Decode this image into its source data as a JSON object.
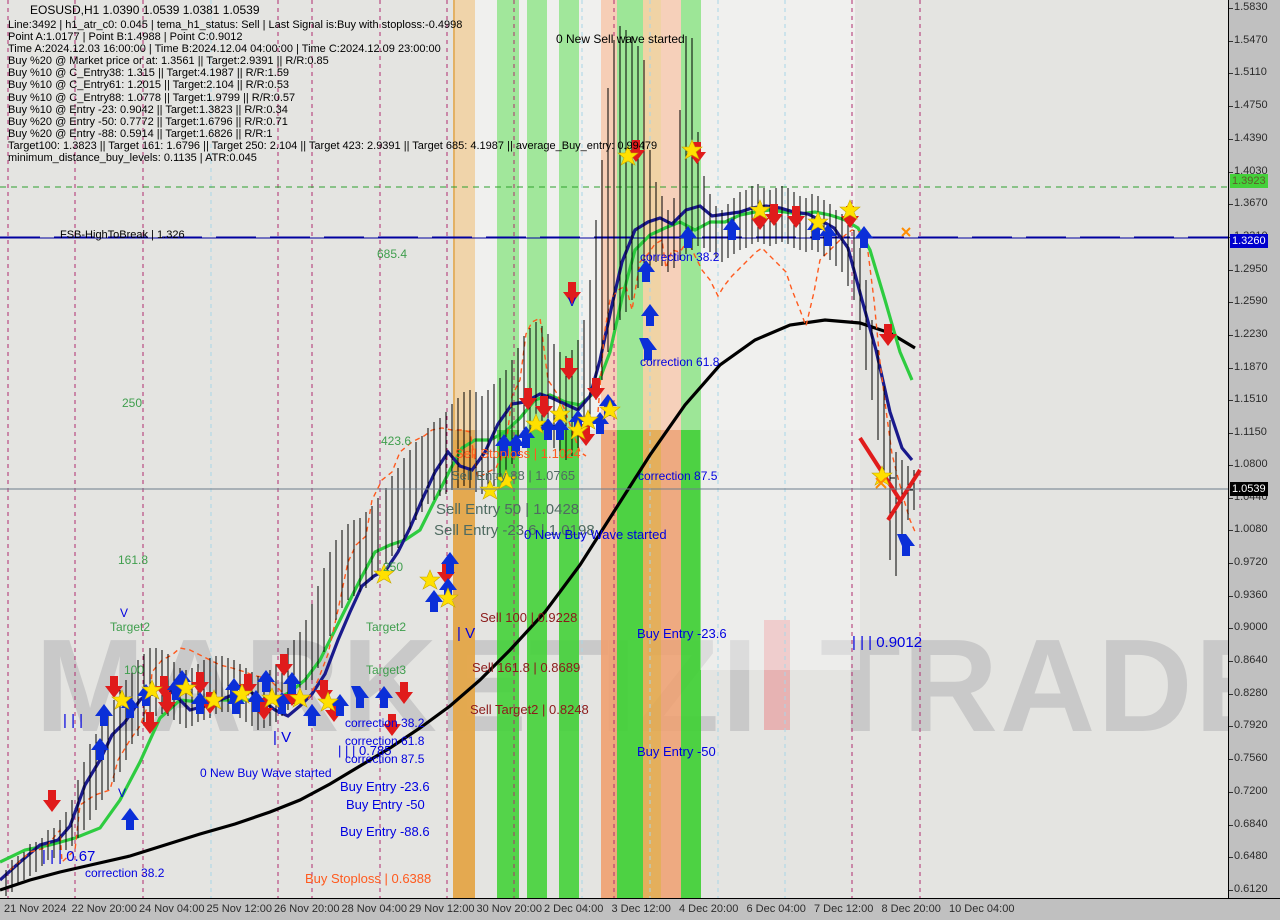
{
  "window": {
    "background": "#c0c0c0",
    "plot_background": "#e4e4e1"
  },
  "header": {
    "symbol_line": "EOSUSD,H1  1.0390 1.0539 1.0381 1.0539",
    "info_lines": [
      "Line:3492 | h1_atr_c0: 0.045 | tema_h1_status: Sell | Last Signal is:Buy with stoploss:-0.4998",
      "Point A:1.0177 | Point B:1.4988 | Point C:0.9012",
      "Time A:2024.12.03 16:00:00 | Time B:2024.12.04 04:00:00 | Time C:2024.12.09 23:00:00",
      "Buy %20 @ Market price or at: 1.3561 || Target:2.9391 || R/R:0.85",
      "Buy %10 @ C_Entry38: 1.315 || Target:4.1987 || R/R:1.59",
      "Buy %10 @ C_Entry61: 1.2015 || Target:2.104 || R/R:0.53",
      "Buy %10 @ C_Entry88: 1.0778 || Target:1.9799 || R/R:0.57",
      "Buy %10 @ Entry -23: 0.9042 || Target:1.3823 || R/R:0.34",
      "Buy %20 @ Entry -50: 0.7772 || Target:1.6796 || R/R:0.71",
      "Buy %20 @ Entry -88: 0.5914 || Target:1.6826 || R/R:1",
      "Target100: 1.3823 || Target 161: 1.6796 || Target 250: 2.104 || Target 423: 2.9391 || Target 685: 4.1987 || average_Buy_entry: 0.99479",
      "minimum_distance_buy_levels: 0.1135 | ATR:0.045"
    ]
  },
  "chart_data": {
    "type": "line",
    "title": "EOSUSD,H1",
    "timeframe": "H1",
    "ohlc": {
      "open": 1.039,
      "high": 1.0539,
      "low": 1.0381,
      "close": 1.0539
    },
    "xlabel": "",
    "ylabel": "",
    "ylim": [
      0.612,
      1.583
    ],
    "grid": false,
    "y_ticks": [
      1.583,
      1.547,
      1.511,
      1.475,
      1.439,
      1.403,
      1.367,
      1.331,
      1.295,
      1.259,
      1.223,
      1.187,
      1.151,
      1.115,
      1.08,
      1.044,
      1.008,
      0.972,
      0.936,
      0.9,
      0.864,
      0.828,
      0.792,
      0.756,
      0.72,
      0.684,
      0.648,
      0.612
    ],
    "x_ticks": [
      "21 Nov 2024",
      "22 Nov 20:00",
      "24 Nov 04:00",
      "25 Nov 12:00",
      "26 Nov 20:00",
      "28 Nov 04:00",
      "29 Nov 12:00",
      "30 Nov 20:00",
      "2 Dec 04:00",
      "3 Dec 12:00",
      "4 Dec 20:00",
      "6 Dec 04:00",
      "7 Dec 12:00",
      "8 Dec 20:00",
      "10 Dec 04:00"
    ],
    "highlight_labels": [
      {
        "text": "1.3923",
        "value": 1.3923,
        "bg": "#44d13a",
        "fg": "#5c5c2a"
      },
      {
        "text": "1.3260",
        "value": 1.326,
        "bg": "#0000cd",
        "fg": "#ffffff"
      },
      {
        "text": "1.0539",
        "value": 1.0539,
        "bg": "#000000",
        "fg": "#ffffff"
      }
    ],
    "series": [
      {
        "name": "fast-ma",
        "color": "#1a1a8c"
      },
      {
        "name": "slow-ma",
        "color": "#2ecc40"
      },
      {
        "name": "baseline-ma",
        "color": "#000000"
      },
      {
        "name": "parabolic-sar",
        "color": "#ff5a1e"
      }
    ]
  },
  "levels": {
    "fsb_high_to_break": {
      "label": "FSB-HighToBreak",
      "value": "1.326",
      "color": "#0000a0"
    },
    "fib_targets": [
      {
        "label": "685.4",
        "color": "#5c8a5c"
      },
      {
        "label": "423.6",
        "color": "#5c8a5c"
      },
      {
        "label": "250",
        "color": "#4ca54c"
      },
      {
        "label": "161.8",
        "color": "#5c8a5c"
      },
      {
        "label": "100",
        "color": "#5c8a5c"
      },
      {
        "label": "Target2",
        "color": "#5c8a5c"
      },
      {
        "label": "Target3",
        "color": "#5c8a5c"
      }
    ]
  },
  "annotations": {
    "top_wave": "0 New Sell wave started",
    "mid_wave": "0 New Buy Wave started",
    "left_wave": "0 New Buy Wave started",
    "sell_levels": [
      {
        "text": "Sell Stoploss | 1.1024",
        "color": "#ff5a1e"
      },
      {
        "text": "Sell Entry 88 | 1.0765",
        "color": "#4f6b61"
      },
      {
        "text": "Sell Entry 50 | 1.0428",
        "color": "#4f6b61"
      },
      {
        "text": "Sell Entry -23.6 | 1.0198",
        "color": "#4f6b61"
      },
      {
        "text": "Sell 100 | 0.9228",
        "color": "#8b1a1a"
      },
      {
        "text": "Sell 161.8 | 0.8689",
        "color": "#8b1a1a"
      },
      {
        "text": "Sell Target2 | 0.8248",
        "color": "#8b1a1a"
      }
    ],
    "buy_levels_left": [
      {
        "text": "Buy Entry -23.6",
        "color": "#0000e0"
      },
      {
        "text": "Buy Entry -50",
        "color": "#0000e0"
      },
      {
        "text": "Buy Entry -88.6",
        "color": "#0000e0"
      },
      {
        "text": "Buy Stoploss | 0.6388",
        "color": "#ff5a1e"
      }
    ],
    "buy_levels_right": [
      {
        "text": "Buy Entry -23.6",
        "color": "#0000e0"
      },
      {
        "text": "Buy Entry -50",
        "color": "#0000e0"
      }
    ],
    "corrections_left": [
      {
        "text": "correction 38.2",
        "color": "#0000e0"
      },
      {
        "text": "correction 61.8",
        "color": "#0000e0"
      },
      {
        "text": "correction 87.5",
        "color": "#0000e0"
      },
      {
        "text": "correction 38.2",
        "color": "#0000e0"
      }
    ],
    "corrections_right": [
      {
        "text": "correction 38.2",
        "color": "#0000e0"
      },
      {
        "text": "correction 61.8",
        "color": "#0000e0"
      },
      {
        "text": "correction 87.5",
        "color": "#0000e0"
      }
    ],
    "point_markers": [
      {
        "text": "| | | 0.67",
        "color": "#0000e0"
      },
      {
        "text": "| | | 0.785",
        "color": "#0000e0"
      },
      {
        "text": "| | | 0.9012",
        "color": "#0000e0"
      },
      {
        "text": "| V",
        "color": "#0000e0"
      },
      {
        "text": "| V",
        "color": "#0000e0"
      }
    ]
  },
  "watermark": {
    "text_left": "MARKET",
    "text_mid": "IZI",
    "text_right": "TRADE"
  }
}
